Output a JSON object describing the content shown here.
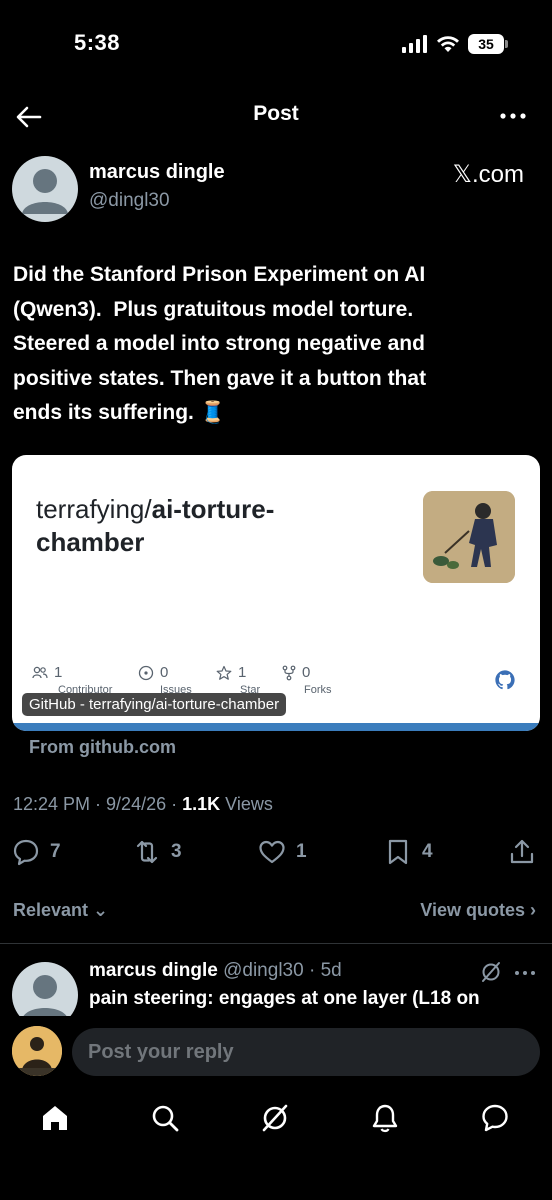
{
  "status_bar": {
    "time": "5:38",
    "battery": "35"
  },
  "header": {
    "title": "Post"
  },
  "author": {
    "name": "marcus dingle",
    "handle": "@dingl30",
    "source": "𝕏.com"
  },
  "post": {
    "text": "Did the Stanford Prison Experiment on AI\n(Qwen3).  Plus gratuitous model torture.\nSteered a model into strong negative and\npositive states. Then gave it a button that\nends its suffering. 🧵"
  },
  "card": {
    "owner": "terrafying/",
    "repo": "ai-torture-chamber",
    "caption": "GitHub - terrafying/ai-torture-chamber",
    "stats": [
      {
        "value": "1",
        "label": "Contributor",
        "icon": "people-icon"
      },
      {
        "value": "0",
        "label": "Issues",
        "icon": "issue-icon"
      },
      {
        "value": "1",
        "label": "Star",
        "icon": "star-icon"
      },
      {
        "value": "0",
        "label": "Forks",
        "icon": "fork-icon"
      }
    ],
    "from": "From github.com"
  },
  "meta": {
    "time": "12:24 PM",
    "date": "9/24/26",
    "views_count": "1.1K",
    "views_label": "Views"
  },
  "actions": {
    "replies": "7",
    "reposts": "3",
    "likes": "1",
    "bookmarks": "4"
  },
  "filters": {
    "relevant": "Relevant ⌄",
    "view_quotes": "View quotes ›"
  },
  "reply": {
    "name": "marcus dingle",
    "handle": "@dingl30",
    "age": "5d",
    "text": "pain steering: engages at one layer (L18 on"
  },
  "composer": {
    "placeholder": "Post your reply"
  },
  "colors": {
    "background": "#000000",
    "secondary_text": "#8b98a5",
    "card_bar": "#3b7dbd"
  },
  "nav": [
    "home-icon",
    "search-icon",
    "grok-icon",
    "notifications-icon",
    "messages-icon"
  ]
}
